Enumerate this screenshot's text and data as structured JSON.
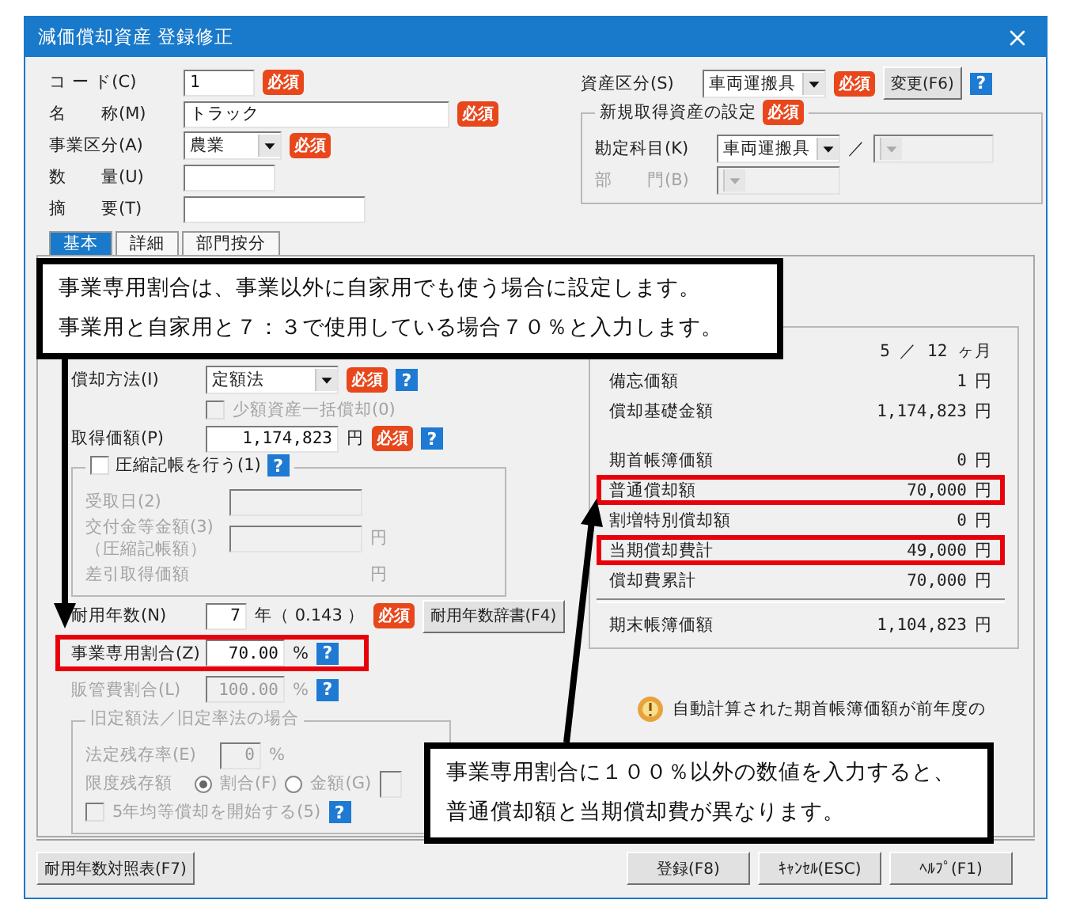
{
  "window": {
    "title": "減価償却資産 登録修正"
  },
  "basic_fields": [
    {
      "label": "コ ー ド(C)",
      "kind": "text",
      "value": "1",
      "badge": "必須"
    },
    {
      "label": "名　　称(M)",
      "kind": "text",
      "value": "トラック",
      "badge": "必須"
    },
    {
      "label": "事業区分(A)",
      "kind": "select",
      "value": "農業",
      "badge": "必須"
    },
    {
      "label": "数　　量(U)",
      "kind": "text"
    },
    {
      "label": "摘　　要(T)",
      "kind": "text"
    }
  ],
  "asset_class": {
    "label": "資産区分(S)",
    "value": "車両運搬具",
    "badge": "必須",
    "button": "変更(F6)",
    "help": "?"
  },
  "new_asset_group": {
    "title": "新規取得資産の設定",
    "badge": "必須",
    "account": {
      "label": "勘定科目(K)",
      "value": "車両運搬具",
      "separator": "／",
      "sub_disabled": true
    },
    "department": {
      "label": "部　　門(B)",
      "disabled": true
    }
  },
  "tabs": [
    {
      "label": "基本",
      "selected": true
    },
    {
      "label": "詳細",
      "selected": false
    },
    {
      "label": "部門按分",
      "selected": false
    }
  ],
  "depreciation": [
    {
      "kind": "select",
      "label": "償却方法(I)",
      "value": "定額法",
      "badge": "必須",
      "help": "?"
    },
    {
      "kind": "check",
      "label": "少額資産一括償却(0)",
      "checked": false,
      "disabled": true
    },
    {
      "kind": "amount",
      "label": "取得価額(P)",
      "value": "1,174,823",
      "unit": "円",
      "badge": "必須",
      "help": "?"
    }
  ],
  "compression": {
    "label": "圧縮記帳を行う(1)",
    "checked": false,
    "help": "?",
    "rows": [
      {
        "label": "受取日(2)",
        "kind": "input",
        "disabled": true
      },
      {
        "label": "交付金等金額(3)",
        "sublabel": "（圧縮記帳額）",
        "kind": "input",
        "unit": "円",
        "disabled": true
      },
      {
        "label": "差引取得価額",
        "kind": "display",
        "unit": "円",
        "disabled": true
      }
    ]
  },
  "useful_life": {
    "label": "耐用年数(N)",
    "value": "7",
    "unit": "年（ 0.143 ）",
    "badge": "必須",
    "button": "耐用年数辞書(F4)"
  },
  "ratios": [
    {
      "label": "事業専用割合(Z)",
      "value": "70.00",
      "unit": "%",
      "help": "?",
      "disabled": false,
      "highlighted": true
    },
    {
      "label": "販管費割合(L)",
      "value": "100.00",
      "unit": "%",
      "help": "?",
      "disabled": true,
      "highlighted": false
    }
  ],
  "old_method": {
    "title": "旧定額法／旧定率法の場合",
    "disabled": true,
    "residual_rate": {
      "label": "法定残存率(E)",
      "value": "0",
      "unit": "%"
    },
    "limit": {
      "label": "限度残存額",
      "options": [
        {
          "label": "割合(F)",
          "selected": true
        },
        {
          "label": "金額(G)",
          "selected": false
        }
      ]
    },
    "equal": {
      "label": "5年均等償却を開始する(5)",
      "checked": false,
      "help": "?"
    }
  },
  "summary": {
    "period": "5 ／ 12 ヶ月",
    "groups": [
      [
        {
          "label": "備忘価額",
          "value": "1",
          "unit": "円",
          "highlighted": false
        },
        {
          "label": "償却基礎金額",
          "value": "1,174,823",
          "unit": "円",
          "highlighted": false
        }
      ],
      [
        {
          "label": "期首帳簿価額",
          "value": "0",
          "unit": "円",
          "highlighted": false
        },
        {
          "label": "普通償却額",
          "value": "70,000",
          "unit": "円",
          "highlighted": true
        },
        {
          "label": "割増特別償却額",
          "value": "0",
          "unit": "円",
          "highlighted": false
        },
        {
          "label": "当期償却費計",
          "value": "49,000",
          "unit": "円",
          "highlighted": true
        },
        {
          "label": "償却費累計",
          "value": "70,000",
          "unit": "円",
          "highlighted": false
        }
      ]
    ],
    "total": {
      "label": "期末帳簿価額",
      "value": "1,104,823",
      "unit": "円"
    }
  },
  "notice": {
    "text": "自動計算された期首帳簿価額が前年度の"
  },
  "footer": {
    "left_button": "耐用年数対照表(F7)",
    "buttons": [
      "登録(F8)",
      "ｷｬﾝｾﾙ(ESC)",
      "ﾍﾙﾌﾟ(F1)"
    ]
  },
  "callouts": [
    {
      "lines": [
        "事業専用割合は、事業以外に自家用でも使う場合に設定します。",
        "事業用と自家用と７：３で使用している場合７０％と入力します。"
      ]
    },
    {
      "lines": [
        "事業専用割合に１００％以外の数値を入力すると、",
        "普通償却額と当期償却費が異なります。"
      ]
    }
  ]
}
